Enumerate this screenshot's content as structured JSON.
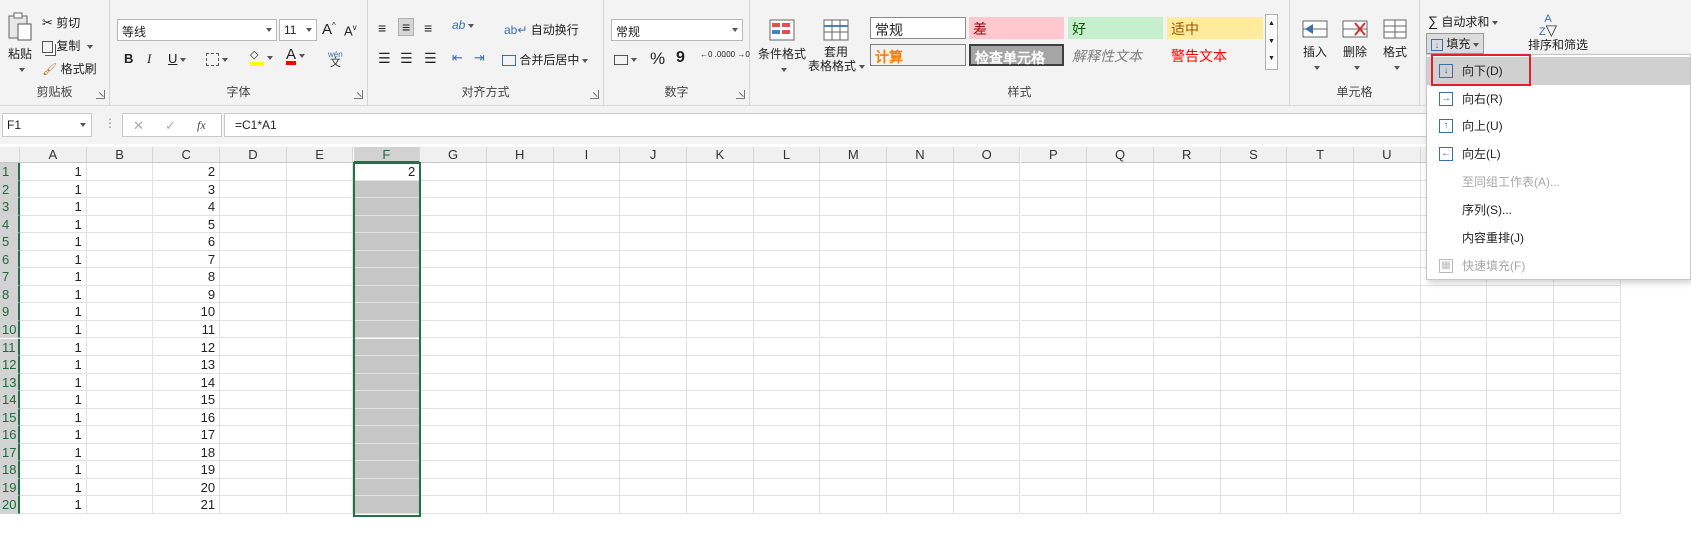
{
  "ribbon": {
    "clipboard": {
      "paste": "粘贴",
      "cut": "剪切",
      "copy": "复制",
      "painter": "格式刷",
      "label": "剪贴板"
    },
    "font": {
      "name": "等线",
      "size": "11",
      "bold": "B",
      "italic": "I",
      "underline": "U",
      "grow": "A",
      "shrink": "A",
      "wen": "wén",
      "wen_char": "文",
      "color_letter": "A",
      "label": "字体"
    },
    "align": {
      "wrap": "自动换行",
      "merge": "合并后居中",
      "label": "对齐方式",
      "orient": "ab"
    },
    "number": {
      "format": "常规",
      "percent": "%",
      "comma": "9",
      "inc_dec": "←0 .00",
      "dec_dec": ".00 →0",
      "label": "数字"
    },
    "styles": {
      "conditional": "条件格式",
      "table_line1": "套用",
      "table_line2": "表格格式",
      "cells": [
        {
          "text": "常规"
        },
        {
          "text": "差"
        },
        {
          "text": "好"
        },
        {
          "text": "适中"
        },
        {
          "text": "计算"
        },
        {
          "text": "检查单元格"
        },
        {
          "text": "解释性文本"
        },
        {
          "text": "警告文本"
        }
      ],
      "label": "样式"
    },
    "cells_grp": {
      "insert": "插入",
      "delete": "删除",
      "format": "格式",
      "label": "单元格"
    },
    "editing": {
      "autosum": "自动求和",
      "fill": "填充",
      "sort": "排序和筛选",
      "sigma": "∑",
      "az_top": "A",
      "az_bottom": "Z"
    }
  },
  "formula_bar": {
    "name_box": "F1",
    "cancel": "✕",
    "enter": "✓",
    "fx": "fx",
    "formula": "=C1*A1",
    "dots": "⋮"
  },
  "columns": [
    "A",
    "B",
    "C",
    "D",
    "E",
    "F",
    "G",
    "H",
    "I",
    "J",
    "K",
    "L",
    "M",
    "N",
    "O",
    "P",
    "Q",
    "R",
    "S",
    "T",
    "U"
  ],
  "rows": [
    {
      "n": "1",
      "a": "1",
      "c": "2",
      "f": "2"
    },
    {
      "n": "2",
      "a": "1",
      "c": "3",
      "f": ""
    },
    {
      "n": "3",
      "a": "1",
      "c": "4",
      "f": ""
    },
    {
      "n": "4",
      "a": "1",
      "c": "5",
      "f": ""
    },
    {
      "n": "5",
      "a": "1",
      "c": "6",
      "f": ""
    },
    {
      "n": "6",
      "a": "1",
      "c": "7",
      "f": ""
    },
    {
      "n": "7",
      "a": "1",
      "c": "8",
      "f": ""
    },
    {
      "n": "8",
      "a": "1",
      "c": "9",
      "f": ""
    },
    {
      "n": "9",
      "a": "1",
      "c": "10",
      "f": ""
    },
    {
      "n": "10",
      "a": "1",
      "c": "11",
      "f": ""
    },
    {
      "n": "11",
      "a": "1",
      "c": "12",
      "f": ""
    },
    {
      "n": "12",
      "a": "1",
      "c": "13",
      "f": ""
    },
    {
      "n": "13",
      "a": "1",
      "c": "14",
      "f": ""
    },
    {
      "n": "14",
      "a": "1",
      "c": "15",
      "f": ""
    },
    {
      "n": "15",
      "a": "1",
      "c": "16",
      "f": ""
    },
    {
      "n": "16",
      "a": "1",
      "c": "17",
      "f": ""
    },
    {
      "n": "17",
      "a": "1",
      "c": "18",
      "f": ""
    },
    {
      "n": "18",
      "a": "1",
      "c": "19",
      "f": ""
    },
    {
      "n": "19",
      "a": "1",
      "c": "20",
      "f": ""
    },
    {
      "n": "20",
      "a": "1",
      "c": "21",
      "f": ""
    }
  ],
  "fill_menu": {
    "items": [
      {
        "label": "向下(D)",
        "icon": "arrow-down-icon",
        "disabled": false,
        "highlight": true
      },
      {
        "label": "向右(R)",
        "icon": "arrow-right-icon",
        "disabled": false,
        "highlight": false
      },
      {
        "label": "向上(U)",
        "icon": "arrow-up-icon",
        "disabled": false,
        "highlight": false
      },
      {
        "label": "向左(L)",
        "icon": "arrow-left-icon",
        "disabled": false,
        "highlight": false
      },
      {
        "label": "至同组工作表(A)...",
        "icon": "",
        "disabled": true,
        "highlight": false
      },
      {
        "label": "序列(S)...",
        "icon": "",
        "disabled": false,
        "highlight": false
      },
      {
        "label": "内容重排(J)",
        "icon": "",
        "disabled": false,
        "highlight": false
      },
      {
        "label": "快速填充(F)",
        "icon": "flash-fill-icon",
        "disabled": true,
        "highlight": false
      }
    ]
  },
  "colors": {
    "accent": "#217346",
    "highlight_box": "#e0202a",
    "bad_bg": "#ffc7ce",
    "good_bg": "#c6efce",
    "neutral_bg": "#ffeb9c",
    "calc_text": "#fa7d00",
    "warn_text": "#ff0000"
  }
}
